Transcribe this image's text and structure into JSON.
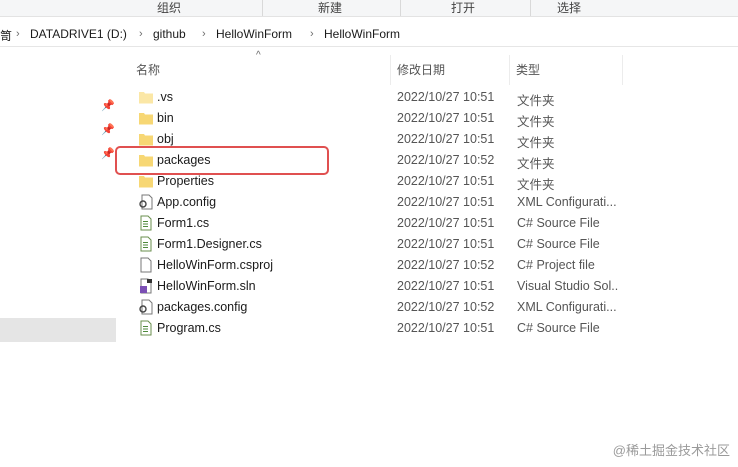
{
  "ribbon": {
    "groups": [
      "组织",
      "新建",
      "打开",
      "选择"
    ]
  },
  "address": {
    "crumbs": [
      "笥",
      "DATADRIVE1 (D:)",
      "github",
      "HelloWinForm",
      "HelloWinForm"
    ]
  },
  "columns": {
    "name": "名称",
    "date": "修改日期",
    "type": "类型"
  },
  "files": [
    {
      "name": ".vs",
      "date": "2022/10/27 10:51",
      "type": "文件夹",
      "icon": "folder-icon"
    },
    {
      "name": "bin",
      "date": "2022/10/27 10:51",
      "type": "文件夹",
      "icon": "folder-icon"
    },
    {
      "name": "obj",
      "date": "2022/10/27 10:51",
      "type": "文件夹",
      "icon": "folder-icon"
    },
    {
      "name": "packages",
      "date": "2022/10/27 10:52",
      "type": "文件夹",
      "icon": "folder-icon"
    },
    {
      "name": "Properties",
      "date": "2022/10/27 10:51",
      "type": "文件夹",
      "icon": "folder-icon"
    },
    {
      "name": "App.config",
      "date": "2022/10/27 10:51",
      "type": "XML Configurati...",
      "icon": "config-file-icon"
    },
    {
      "name": "Form1.cs",
      "date": "2022/10/27 10:51",
      "type": "C# Source File",
      "icon": "cs-file-icon"
    },
    {
      "name": "Form1.Designer.cs",
      "date": "2022/10/27 10:51",
      "type": "C# Source File",
      "icon": "cs-file-icon"
    },
    {
      "name": "HelloWinForm.csproj",
      "date": "2022/10/27 10:52",
      "type": "C# Project file",
      "icon": "project-file-icon"
    },
    {
      "name": "HelloWinForm.sln",
      "date": "2022/10/27 10:51",
      "type": "Visual Studio Sol...",
      "icon": "sln-file-icon"
    },
    {
      "name": "packages.config",
      "date": "2022/10/27 10:52",
      "type": "XML Configurati...",
      "icon": "config-file-icon"
    },
    {
      "name": "Program.cs",
      "date": "2022/10/27 10:51",
      "type": "C# Source File",
      "icon": "cs-file-icon"
    }
  ],
  "highlight_color": "#e05050",
  "watermark": "@稀土掘金技术社区"
}
